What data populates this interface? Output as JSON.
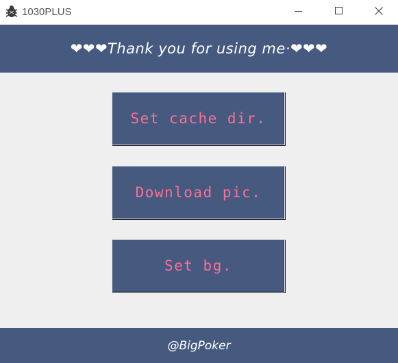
{
  "window": {
    "title": "1030PLUS",
    "app_icon": "bug-icon",
    "controls": {
      "minimize_icon": "minimize-icon",
      "maximize_icon": "maximize-icon",
      "close_icon": "close-icon"
    }
  },
  "banner": {
    "text": "❤❤❤Thank you for using me·❤❤❤"
  },
  "actions": [
    {
      "label": "Set cache dir."
    },
    {
      "label": "Download pic."
    },
    {
      "label": "Set bg."
    }
  ],
  "footer": {
    "text": "@BigPoker"
  },
  "colors": {
    "accent": "#465a80",
    "label": "#ff6e94",
    "background": "#efefef"
  }
}
